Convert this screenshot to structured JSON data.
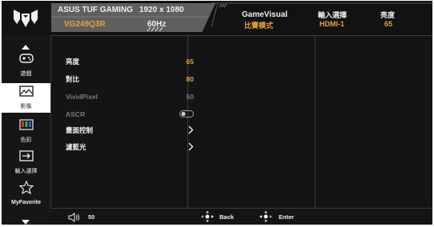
{
  "header": {
    "brand": "ASUS TUF GAMING",
    "model": "VG249Q3R",
    "resolution": "1920 x 1080",
    "refresh": "60Hz",
    "gamevisual": {
      "label": "GameVisual",
      "value": "比賽模式"
    },
    "input": {
      "label": "輸入選擇",
      "value": "HDMI-1"
    },
    "brightness": {
      "label": "亮度",
      "value": "65"
    }
  },
  "sidebar": {
    "items": [
      {
        "label": "遊戲",
        "icon": "gamepad-icon"
      },
      {
        "label": "影像",
        "icon": "image-icon"
      },
      {
        "label": "色彩",
        "icon": "color-bars-icon"
      },
      {
        "label": "輸入選擇",
        "icon": "input-select-icon"
      },
      {
        "label": "MyFavorite",
        "icon": "star-icon"
      }
    ],
    "selected": "影像"
  },
  "menu": {
    "items": [
      {
        "label": "亮度",
        "value": "65"
      },
      {
        "label": "對比",
        "value": "80"
      },
      {
        "label": "VividPixel",
        "value": "50"
      },
      {
        "label": "ASCR",
        "state": "off"
      },
      {
        "label": "畫面控制"
      },
      {
        "label": "濾藍光"
      }
    ]
  },
  "footer": {
    "volume": "50",
    "back": "Back",
    "enter": "Enter"
  },
  "colors": {
    "accent": "#e8a13c",
    "panel": "#5f5f5f",
    "background": "#141414"
  }
}
